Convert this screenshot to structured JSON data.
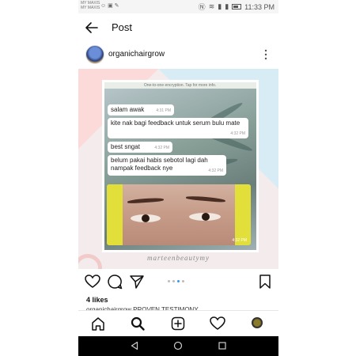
{
  "status_bar": {
    "carrier_line1": "MY MAXIS",
    "carrier_line2": "MY MAXIS",
    "time": "11:33 PM"
  },
  "header": {
    "title": "Post",
    "back_icon": "back-arrow-icon"
  },
  "post": {
    "username": "organichairgrow",
    "likes": "4 likes",
    "caption": "organichairgrow PROVEN TESTIMONY",
    "watermark": "marteenbeautymy",
    "chat": {
      "top_strip": "One-to-one encryption. Tap for more info.",
      "messages": [
        {
          "text": "salam awak",
          "time": "4:31 PM"
        },
        {
          "text": "kite nak bagi feedback untuk serum bulu mate",
          "time": "4:32 PM"
        },
        {
          "text": "best sngat",
          "time": "4:32 PM"
        },
        {
          "text": "belum pakai habis sebotol lagi dah nampak feedback nye",
          "time": "4:32 PM"
        }
      ],
      "image_time": "4:32 PM"
    },
    "carousel": {
      "count": 4,
      "active_index": 2
    }
  },
  "actions": [
    "heart-icon",
    "comment-icon",
    "share-icon",
    "bookmark-icon"
  ],
  "bottom_nav": [
    "home-icon",
    "search-icon",
    "add-post-icon",
    "activity-heart-icon",
    "profile-avatar"
  ],
  "colors": {
    "accent": "#3897f0",
    "text": "#111111",
    "system_nav": "#000000"
  }
}
